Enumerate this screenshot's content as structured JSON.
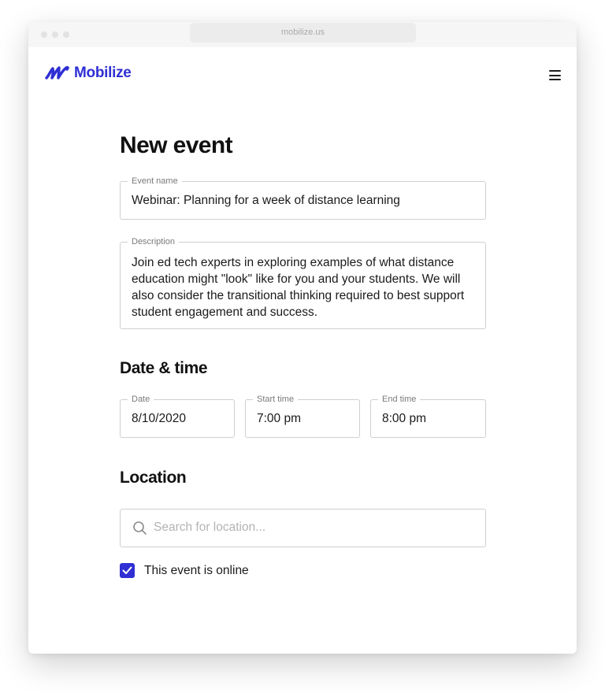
{
  "browser": {
    "url": "mobilize.us"
  },
  "brand": {
    "name": "Mobilize",
    "color": "#2f2fd4",
    "logo_icon": "mobilize-wave-logo"
  },
  "header": {
    "menu_icon": "hamburger-menu-icon"
  },
  "form": {
    "title": "New event",
    "event_name": {
      "label": "Event name",
      "value": "Webinar: Planning for a week of distance learning"
    },
    "description": {
      "label": "Description",
      "value": "Join ed tech experts in exploring examples of what distance education might \"look\" like for you and your students. We will also consider the transitional thinking required to best support student engagement and success."
    },
    "date_time": {
      "heading": "Date & time",
      "date": {
        "label": "Date",
        "value": "8/10/2020"
      },
      "start_time": {
        "label": "Start time",
        "value": "7:00 pm"
      },
      "end_time": {
        "label": "End time",
        "value": "8:00 pm"
      }
    },
    "location": {
      "heading": "Location",
      "search_placeholder": "Search for location...",
      "search_icon": "search-icon",
      "online_checkbox": {
        "label": "This event is online",
        "checked": true
      }
    }
  }
}
